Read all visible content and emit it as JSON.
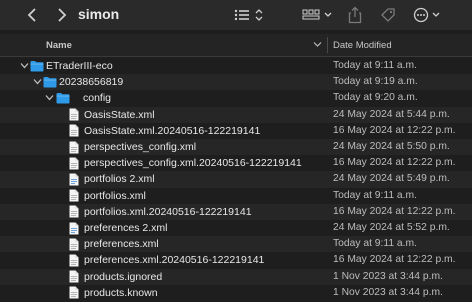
{
  "window": {
    "title": "simon"
  },
  "header": {
    "name_label": "Name",
    "date_label": "Date Modified"
  },
  "rows": [
    {
      "name": "ETraderIII-eco",
      "date": "Today at 9:11 a.m.",
      "kind": "folder",
      "level": 0
    },
    {
      "name": "20238656819",
      "date": "Today at 9:19 a.m.",
      "kind": "folder",
      "level": 1
    },
    {
      "name": "config",
      "date": "Today at 9:20 a.m.",
      "kind": "folder",
      "level": 2
    },
    {
      "name": "OasisState.xml",
      "date": "24 May 2024 at 5:44 p.m.",
      "kind": "file",
      "level": 3
    },
    {
      "name": "OasisState.xml.20240516-122219141",
      "date": "16 May 2024 at 12:22 p.m.",
      "kind": "file",
      "level": 3
    },
    {
      "name": "perspectives_config.xml",
      "date": "24 May 2024 at 5:50 p.m.",
      "kind": "file",
      "level": 3
    },
    {
      "name": "perspectives_config.xml.20240516-122219141",
      "date": "16 May 2024 at 12:22 p.m.",
      "kind": "file",
      "level": 3
    },
    {
      "name": "portfolios 2.xml",
      "date": "24 May 2024 at 5:49 p.m.",
      "kind": "file-blue",
      "level": 3
    },
    {
      "name": "portfolios.xml",
      "date": "Today at 9:11 a.m.",
      "kind": "file",
      "level": 3
    },
    {
      "name": "portfolios.xml.20240516-122219141",
      "date": "16 May 2024 at 12:22 p.m.",
      "kind": "file",
      "level": 3
    },
    {
      "name": "preferences 2.xml",
      "date": "24 May 2024 at 5:52 p.m.",
      "kind": "file-blue",
      "level": 3
    },
    {
      "name": "preferences.xml",
      "date": "Today at 9:11 a.m.",
      "kind": "file",
      "level": 3
    },
    {
      "name": "preferences.xml.20240516-122219141",
      "date": "16 May 2024 at 12:22 p.m.",
      "kind": "file",
      "level": 3
    },
    {
      "name": "products.ignored",
      "date": "1 Nov 2023 at 3:44 p.m.",
      "kind": "file",
      "level": 3
    },
    {
      "name": "products.known",
      "date": "1 Nov 2023 at 3:44 p.m.",
      "kind": "file",
      "level": 3
    }
  ],
  "icons": {
    "back": "chevron-left-icon",
    "forward": "chevron-right-icon",
    "view": "list-view-icon",
    "group": "group-grid-icon",
    "share": "share-icon",
    "tag": "tag-icon",
    "more": "more-icon"
  },
  "colors": {
    "folder": "#2f9ae8",
    "background": "#1e1e1e"
  }
}
